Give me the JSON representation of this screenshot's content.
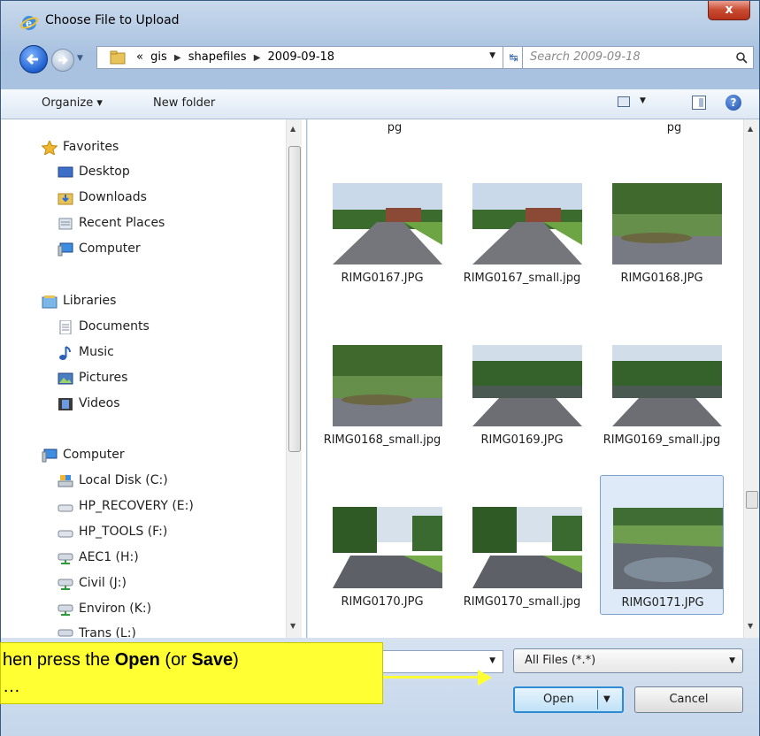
{
  "window": {
    "title": "Choose File to Upload",
    "close_label": "x"
  },
  "address": {
    "crumbs": [
      "«",
      "gis",
      "shapefiles",
      "2009-09-18"
    ],
    "search_placeholder": "Search 2009-09-18"
  },
  "toolbar": {
    "organize": "Organize ▾",
    "new_folder": "New folder"
  },
  "nav": {
    "favorites": "Favorites",
    "fav_items": [
      "Desktop",
      "Downloads",
      "Recent Places",
      "Computer"
    ],
    "libraries": "Libraries",
    "lib_items": [
      "Documents",
      "Music",
      "Pictures",
      "Videos"
    ],
    "computer": "Computer",
    "drives": [
      "Local Disk (C:)",
      "HP_RECOVERY (E:)",
      "HP_TOOLS (F:)",
      "AEC1 (H:)",
      "Civil (J:)",
      "Environ (K:)",
      "Trans (L:)"
    ]
  },
  "files": {
    "top_partial": [
      "pg",
      "",
      "pg"
    ],
    "items": [
      "RIMG0167.JPG",
      "RIMG0167_small.jpg",
      "RIMG0168.JPG",
      "RIMG0168_small.jpg",
      "RIMG0169.JPG",
      "RIMG0169_small.jpg",
      "RIMG0170.JPG",
      "RIMG0170_small.jpg",
      "RIMG0171.JPG"
    ],
    "selected": "RIMG0171.JPG"
  },
  "bottom": {
    "filter": "All Files (*.*)",
    "open": "Open",
    "cancel": "Cancel"
  },
  "callout": {
    "line1_a": "hen press the ",
    "open_word": "Open",
    "line1_b": " (or ",
    "save_word": "Save",
    "line1_c": ")",
    "line2": "…"
  },
  "colors": {
    "callout": "#ffff33",
    "accent": "#2c8bd3"
  }
}
